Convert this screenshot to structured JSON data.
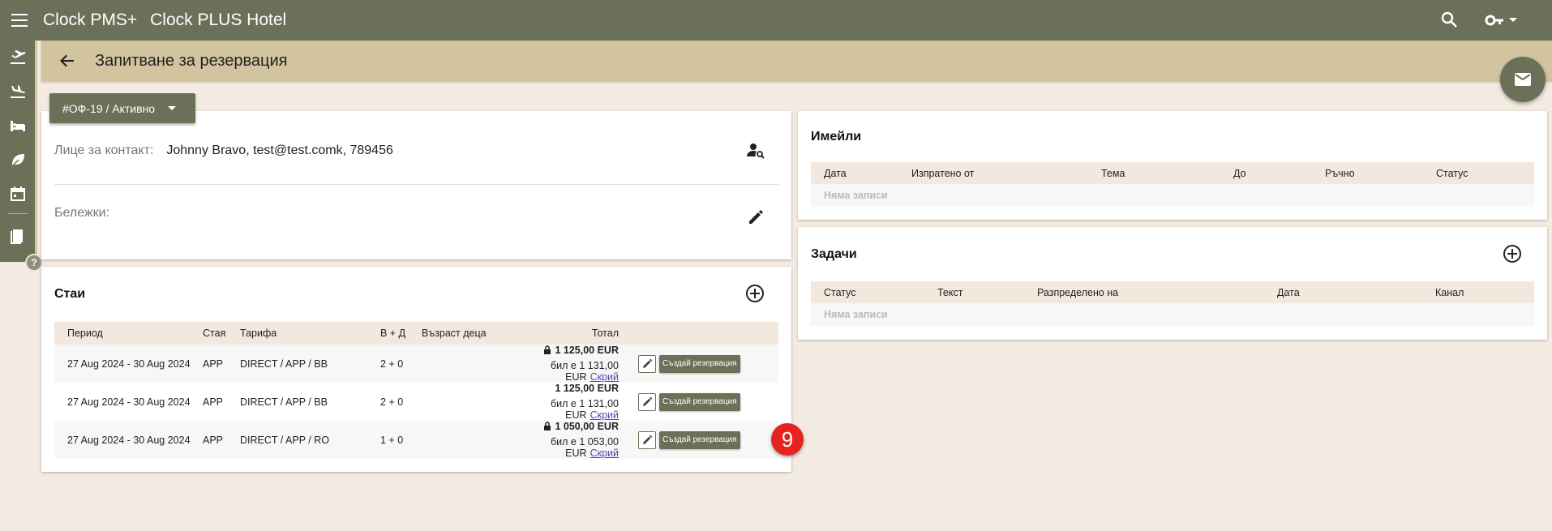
{
  "app": {
    "name": "Clock PMS+",
    "hotel": "Clock PLUS Hotel"
  },
  "page": {
    "title": "Запитване за резервация"
  },
  "status": {
    "label": "#ОФ-19 / Активно"
  },
  "contact": {
    "label": "Лице за контакт:",
    "value": "Johnny Bravo, test@test.comk, 789456",
    "notes_label": "Бележки:"
  },
  "rooms": {
    "title": "Стаи",
    "headers": [
      "Период",
      "Стая",
      "Тарифа",
      "В + Д",
      "Възраст деца",
      "Тотал"
    ],
    "rows": [
      {
        "period": "27 Aug 2024 - 30 Aug 2024",
        "room": "APP",
        "rate": "DIRECT / APP / BB",
        "guests": "2 + 0",
        "ages": "",
        "total": "1 125,00 EUR",
        "was": "бил е 1 131,00 EUR",
        "hide": "Скрий",
        "locked": true,
        "create": "Създай резервация"
      },
      {
        "period": "27 Aug 2024 - 30 Aug 2024",
        "room": "APP",
        "rate": "DIRECT / APP / BB",
        "guests": "2 + 0",
        "ages": "",
        "total": "1 125,00 EUR",
        "was": "бил е 1 131,00 EUR",
        "hide": "Скрий",
        "locked": false,
        "create": "Създай резервация"
      },
      {
        "period": "27 Aug 2024 - 30 Aug 2024",
        "room": "APP",
        "rate": "DIRECT / APP / RO",
        "guests": "1 + 0",
        "ages": "",
        "total": "1 050,00 EUR",
        "was": "бил е 1 053,00 EUR",
        "hide": "Скрий",
        "locked": true,
        "create": "Създай резервация"
      }
    ]
  },
  "step_badge": "9",
  "emails": {
    "title": "Имейли",
    "headers": [
      "Дата",
      "Изпратено от",
      "Тема",
      "До",
      "Ръчно",
      "Статус"
    ],
    "empty": "Няма записи"
  },
  "tasks": {
    "title": "Задачи",
    "headers": [
      "Статус",
      "Текст",
      "Разпределено на",
      "Дата",
      "Канал"
    ],
    "empty": "Няма записи"
  },
  "help": {
    "label": "?"
  },
  "colors": {
    "primary": "#6b7158",
    "titlebar": "#d3c4a0",
    "background": "#f3ebe2",
    "header_row": "#f3e8de",
    "badge": "#e8231f"
  }
}
